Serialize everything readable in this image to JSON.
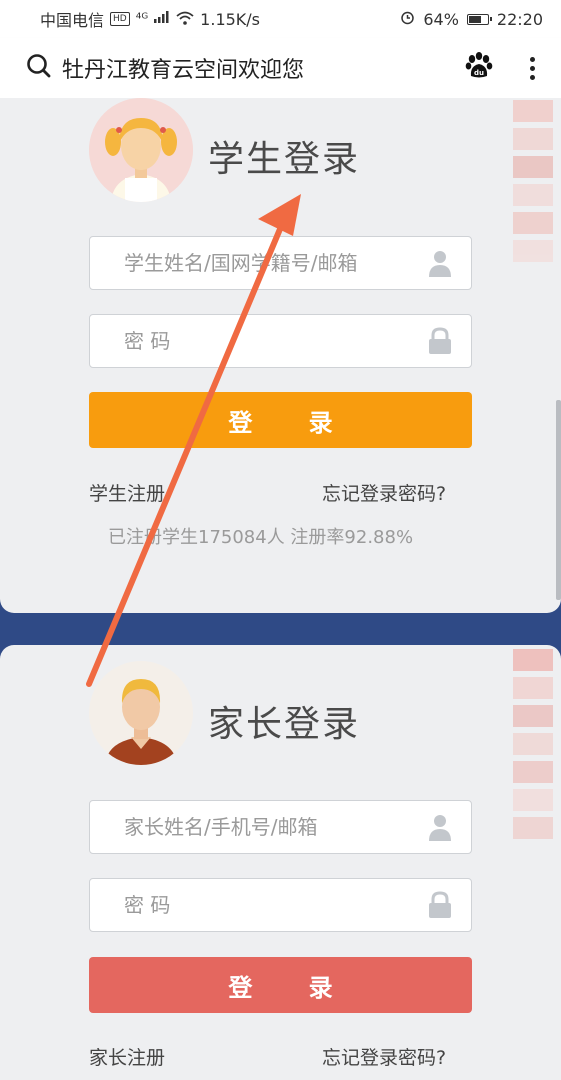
{
  "status": {
    "carrier": "中国电信",
    "hd": "HD",
    "network": "⁴ᴳ",
    "speed": "1.15K/s",
    "battery": "64%",
    "time": "22:20"
  },
  "nav": {
    "title": "牡丹江教育云空间欢迎您"
  },
  "student": {
    "title": "学生登录",
    "username_placeholder": "学生姓名/国网学籍号/邮箱",
    "password_placeholder": "密 码",
    "login_label": "登 录",
    "register_link": "学生注册",
    "forgot_link": "忘记登录密码?",
    "stats": "已注册学生175084人 注册率92.88%"
  },
  "parent": {
    "title": "家长登录",
    "username_placeholder": "家长姓名/手机号/邮箱",
    "password_placeholder": "密 码",
    "login_label": "登 录",
    "register_link": "家长注册",
    "forgot_link": "忘记登录密码?"
  },
  "colors": {
    "student_button": "#f89c0e",
    "parent_button": "#e4675f",
    "annotation_arrow": "#f06a42"
  }
}
